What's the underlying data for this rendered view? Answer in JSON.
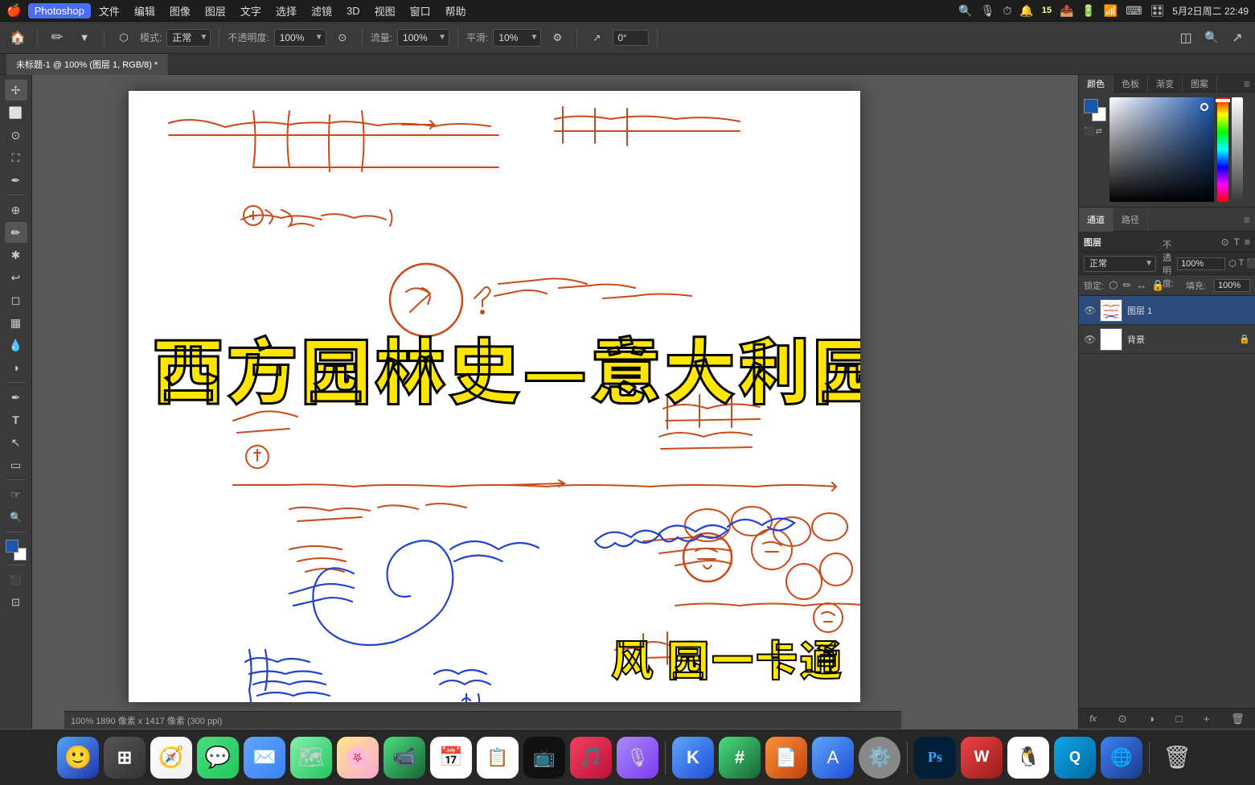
{
  "menubar": {
    "apple": "🍎",
    "items": [
      "Photoshop",
      "文件",
      "编辑",
      "图像",
      "图层",
      "文字",
      "选择",
      "滤镜",
      "3D",
      "视图",
      "窗口",
      "帮助"
    ],
    "active_item": "Photoshop",
    "right": {
      "time": "5月2日周二  22:49",
      "battery": "🔋",
      "wifi": "📶",
      "search": "🔍",
      "notification": "🔔",
      "count": "15"
    }
  },
  "toolbar": {
    "mode_label": "模式:",
    "mode_value": "正常",
    "opacity_label": "不透明度:",
    "opacity_value": "100%",
    "flow_label": "流量:",
    "flow_value": "100%",
    "smooth_label": "平滑:",
    "smooth_value": "10%",
    "angle_label": "",
    "angle_value": "0°"
  },
  "tab": {
    "title": "未标题-1 @ 100% (图层 1, RGB/8) *"
  },
  "canvas": {
    "main_title": "西方园林史—意大利园林",
    "watermark": "风 园一卡通",
    "status": "100%  1890 像素 x 1417 像素 (300 ppi)"
  },
  "color_panel": {
    "tabs": [
      "颜色",
      "色板",
      "渐变",
      "图案"
    ],
    "active_tab": "颜色",
    "channel_tabs": [
      "通道",
      "路径"
    ],
    "active_channel": "通道"
  },
  "layers_panel": {
    "normal_label": "正常",
    "opacity_label": "不透明度:",
    "opacity_value": "100%",
    "lock_label": "锁定:",
    "fill_label": "填充:",
    "fill_value": "100%",
    "layers": [
      {
        "name": "图层 1",
        "visible": true,
        "active": true,
        "type": "sketch",
        "locked": false
      },
      {
        "name": "背景",
        "visible": true,
        "active": false,
        "type": "white",
        "locked": true
      }
    ],
    "footer_icons": [
      "fx",
      "✱",
      "□",
      "🗑"
    ]
  },
  "tools": {
    "items": [
      "⬆",
      "✏",
      "⚪",
      "🔲",
      "⬡",
      "✂",
      "✒",
      "🖊",
      "🖌",
      "🩹",
      "🖍",
      "🖊",
      "T",
      "⬛",
      "⊙",
      "🔍",
      "☞"
    ]
  },
  "dock": {
    "items": [
      {
        "name": "finder",
        "emoji": "🙂",
        "color": "#4fa4ff"
      },
      {
        "name": "launchpad",
        "emoji": "⊞",
        "color": "#666"
      },
      {
        "name": "safari",
        "emoji": "🧭",
        "color": "#1a7aff"
      },
      {
        "name": "messages",
        "emoji": "💬",
        "color": "#4ade80"
      },
      {
        "name": "mail",
        "emoji": "✉️",
        "color": "#fff"
      },
      {
        "name": "maps",
        "emoji": "🗺",
        "color": "#22c55e"
      },
      {
        "name": "photos",
        "emoji": "🌸",
        "color": "#f9a8d4"
      },
      {
        "name": "facetime",
        "emoji": "📹",
        "color": "#4ade80"
      },
      {
        "name": "calendar",
        "emoji": "📅",
        "color": "#f87171"
      },
      {
        "name": "reminders",
        "emoji": "📋",
        "color": "#fde68a"
      },
      {
        "name": "appletv",
        "emoji": "📺",
        "color": "#222"
      },
      {
        "name": "music",
        "emoji": "🎵",
        "color": "#f87171"
      },
      {
        "name": "podcasts",
        "emoji": "🎙",
        "color": "#a78bfa"
      },
      {
        "name": "keynote",
        "emoji": "🅺",
        "color": "#60a5fa"
      },
      {
        "name": "numbers",
        "emoji": "🔢",
        "color": "#4ade80"
      },
      {
        "name": "pages",
        "emoji": "📄",
        "color": "#f97316"
      },
      {
        "name": "appstore",
        "emoji": "🅐",
        "color": "#60a5fa"
      },
      {
        "name": "systemprefs",
        "emoji": "⚙️",
        "color": "#aaa"
      },
      {
        "name": "ps",
        "emoji": "Ps",
        "color": "#001e36"
      },
      {
        "name": "wps",
        "emoji": "W",
        "color": "#c00"
      },
      {
        "name": "wangwang",
        "emoji": "🐧",
        "color": "#f97316"
      },
      {
        "name": "iiqiye",
        "emoji": "Q",
        "color": "#09f"
      },
      {
        "name": "browser2",
        "emoji": "🌐",
        "color": "#1d4ed8"
      },
      {
        "name": "trash",
        "emoji": "🗑",
        "color": "#888"
      }
    ]
  }
}
